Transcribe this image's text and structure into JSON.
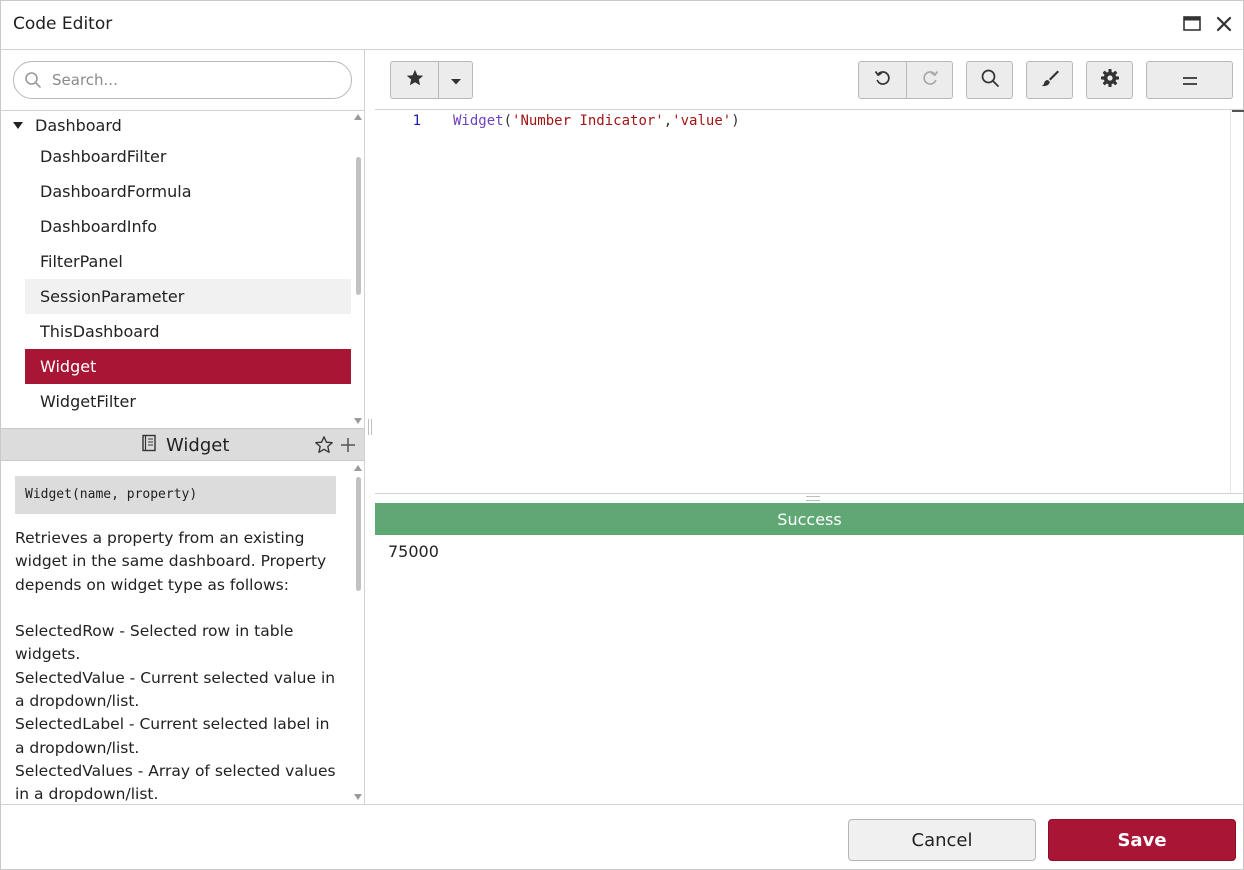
{
  "window": {
    "title": "Code Editor",
    "maximize_icon": "window-maximize-icon",
    "close_icon": "close-icon"
  },
  "search": {
    "placeholder": "Search...",
    "value": ""
  },
  "tree": {
    "root_label": "Dashboard",
    "items": [
      {
        "label": "DashboardFilter",
        "state": "normal"
      },
      {
        "label": "DashboardFormula",
        "state": "normal"
      },
      {
        "label": "DashboardInfo",
        "state": "normal"
      },
      {
        "label": "FilterPanel",
        "state": "normal"
      },
      {
        "label": "SessionParameter",
        "state": "hover"
      },
      {
        "label": "ThisDashboard",
        "state": "normal"
      },
      {
        "label": "Widget",
        "state": "selected"
      },
      {
        "label": "WidgetFilter",
        "state": "normal"
      }
    ]
  },
  "doc": {
    "title": "Widget",
    "signature": "Widget(name, property)",
    "paragraphs": [
      "Retrieves a property from an existing widget in the same dashboard.  Property depends on widget type as follows:",
      "",
      "SelectedRow - Selected row in table widgets.",
      "SelectedValue - Current selected value in a dropdown/list.",
      "SelectedLabel - Current selected label in a dropdown/list.",
      "SelectedValues - Array of selected values in a dropdown/list."
    ]
  },
  "toolbar": {
    "buttons": [
      "favorite-star",
      "favorite-dropdown",
      "undo",
      "redo",
      "search",
      "format-brush",
      "settings",
      "menu"
    ]
  },
  "editor": {
    "line_number": "1",
    "code": {
      "fn": "Widget",
      "open": "(",
      "arg1": "'Number Indicator'",
      "comma": ",",
      "arg2": "'value'",
      "close": ")"
    }
  },
  "result": {
    "status": "Success",
    "status_color": "#5fa874",
    "value": "75000"
  },
  "footer": {
    "cancel_label": "Cancel",
    "save_label": "Save"
  },
  "colors": {
    "accent": "#a81535",
    "success": "#5fa874"
  }
}
